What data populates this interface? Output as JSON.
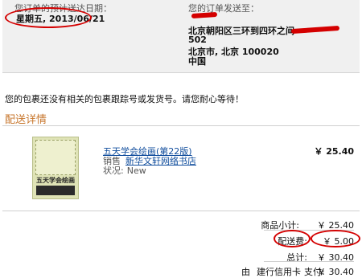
{
  "delivery": {
    "estimate_label": "您订单的预计送达日期：",
    "estimate_date": "星期五, 2013/06/21"
  },
  "address": {
    "label": "您的订单发送至：",
    "line1": "北京朝阳区三环到四环之间",
    "line2": "502",
    "line3": "北京市, 北京  100020",
    "line4": "中国"
  },
  "notice": "您的包裹还没有相关的包裹跟踪号或发货号。请您耐心等待！",
  "details_title": "配送详情",
  "item": {
    "cover_title": "五天学会绘画",
    "title": "五天学会绘画(第22版)",
    "seller_label": "销售",
    "seller": "新华文轩网络书店",
    "condition_label": "状况:",
    "condition": "New",
    "price": "￥ 25.40"
  },
  "totals": {
    "subtotal_label": "商品小计:",
    "subtotal": "￥ 25.40",
    "shipping_label": "配送费:",
    "shipping": "￥ 5.00",
    "total_label": "总计:",
    "total": "￥ 30.40",
    "payment_prefix": "由",
    "payment_method": "建行信用卡",
    "payment_label": "支付:",
    "payment": "￥ 30.40"
  },
  "colors": {
    "annotation_red": "#d40000",
    "section_orange": "#c7762c",
    "link_blue": "#0f4c9c",
    "summary_bg": "#f0f0f0"
  }
}
